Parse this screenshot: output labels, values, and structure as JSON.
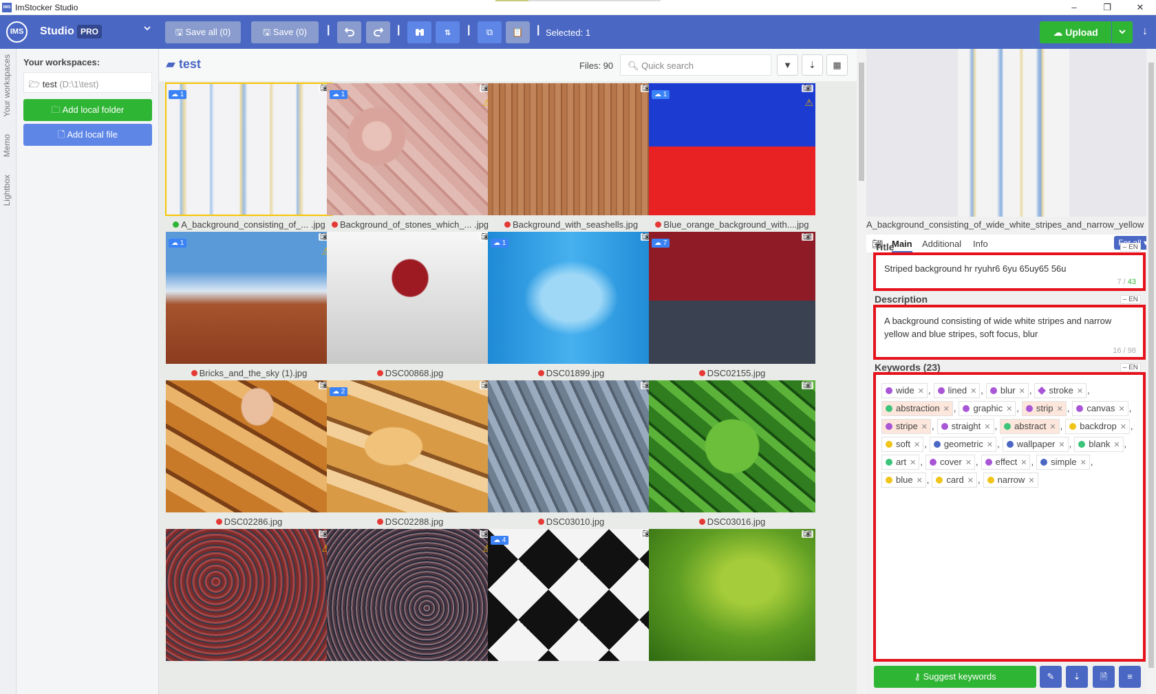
{
  "window": {
    "title": "ImStocker Studio",
    "app_icon": "IMS",
    "minimize": "–",
    "restore": "❐",
    "close": "✕"
  },
  "toolbar": {
    "logo": "IMS",
    "brand": "Studio",
    "badge": "PRO",
    "save_all": "Save all (0)",
    "save": "Save (0)",
    "selected": "Selected: 1",
    "upload": "Upload",
    "accent": "#4a67c4",
    "green": "#2fb534"
  },
  "vtabs": [
    "Your workspaces",
    "Memo",
    "Lightbox"
  ],
  "workspace": {
    "label": "Your workspaces:",
    "item_name": "test",
    "item_path": "(D:\\1\\test)",
    "add_folder": "Add local folder",
    "add_file": "Add local file"
  },
  "gallery": {
    "folder": "test",
    "files": "Files: 90",
    "search_placeholder": "Quick search",
    "tiles": [
      {
        "name": "A_background_consisting_of_... .jpg",
        "badge": "1",
        "warn": false,
        "status": "green",
        "selected": true
      },
      {
        "name": "Background_of_stones_which_... .jpg",
        "badge": "1",
        "warn": true,
        "status": "red"
      },
      {
        "name": "Background_with_seashells.jpg",
        "badge": "",
        "warn": false,
        "status": "red"
      },
      {
        "name": "Blue_orange_background_with....jpg",
        "badge": "1",
        "warn": true,
        "status": "red"
      },
      {
        "name": "Bricks_and_the_sky (1).jpg",
        "badge": "1",
        "warn": true,
        "status": "red"
      },
      {
        "name": "DSC00868.jpg",
        "badge": "",
        "warn": false,
        "status": "red"
      },
      {
        "name": "DSC01899.jpg",
        "badge": "1",
        "warn": false,
        "status": "red"
      },
      {
        "name": "DSC02155.jpg",
        "badge": "7",
        "warn": false,
        "status": "red"
      },
      {
        "name": "DSC02286.jpg",
        "badge": "",
        "warn": false,
        "status": "red"
      },
      {
        "name": "DSC02288.jpg",
        "badge": "2",
        "warn": false,
        "status": "red"
      },
      {
        "name": "DSC03010.jpg",
        "badge": "",
        "warn": false,
        "status": "red"
      },
      {
        "name": "DSC03016.jpg",
        "badge": "",
        "warn": false,
        "status": "red"
      },
      {
        "name": "",
        "badge": "",
        "warn": true,
        "status": ""
      },
      {
        "name": "",
        "badge": "",
        "warn": true,
        "status": ""
      },
      {
        "name": "",
        "badge": "4",
        "warn": false,
        "status": ""
      },
      {
        "name": "",
        "badge": "",
        "warn": false,
        "status": ""
      }
    ]
  },
  "panel": {
    "filename": "A_background_consisting_of_wide_white_stripes_and_narrow_yellow",
    "tabs": [
      "Main",
      "Additional",
      "Info"
    ],
    "for_all": "For all ▾",
    "lang": "EN",
    "title_label": "Title",
    "title_value": "Striped background hr ryuhr6 6yu 65uy65 56u",
    "title_count_used": "7",
    "title_count_max": "43",
    "desc_label": "Description",
    "desc_value": "A background consisting of wide white stripes and narrow yellow and blue stripes, soft focus, blur",
    "desc_count": "16 / 98",
    "kw_label": "Keywords (23)",
    "keywords": [
      {
        "t": "wide",
        "c": "#a855d6"
      },
      {
        "t": "lined",
        "c": "#a855d6"
      },
      {
        "t": "blur",
        "c": "#a855d6"
      },
      {
        "t": "stroke",
        "c": "#a855d6",
        "shape": "diamond"
      },
      {
        "t": "abstraction",
        "c": "#3cc47a",
        "hl": true
      },
      {
        "t": "graphic",
        "c": "#a855d6"
      },
      {
        "t": "strip",
        "c": "#a855d6",
        "hl": true
      },
      {
        "t": "canvas",
        "c": "#a855d6"
      },
      {
        "t": "stripe",
        "c": "#a855d6",
        "hl": true
      },
      {
        "t": "straight",
        "c": "#a855d6"
      },
      {
        "t": "abstract",
        "c": "#3cc47a",
        "hl": true
      },
      {
        "t": "backdrop",
        "c": "#f0c419",
        "lead": true
      },
      {
        "t": "soft",
        "c": "#f0c419"
      },
      {
        "t": "geometric",
        "c": "#4a67c4"
      },
      {
        "t": "wallpaper",
        "c": "#4a67c4"
      },
      {
        "t": "blank",
        "c": "#3cc47a"
      },
      {
        "t": "art",
        "c": "#3cc47a"
      },
      {
        "t": "cover",
        "c": "#a855d6"
      },
      {
        "t": "effect",
        "c": "#a855d6"
      },
      {
        "t": "simple",
        "c": "#4a67c4"
      },
      {
        "t": "blue",
        "c": "#f0c419"
      },
      {
        "t": "card",
        "c": "#f0c419"
      },
      {
        "t": "narrow",
        "c": "#f0c419",
        "last": true
      }
    ],
    "suggest": "Suggest keywords"
  }
}
